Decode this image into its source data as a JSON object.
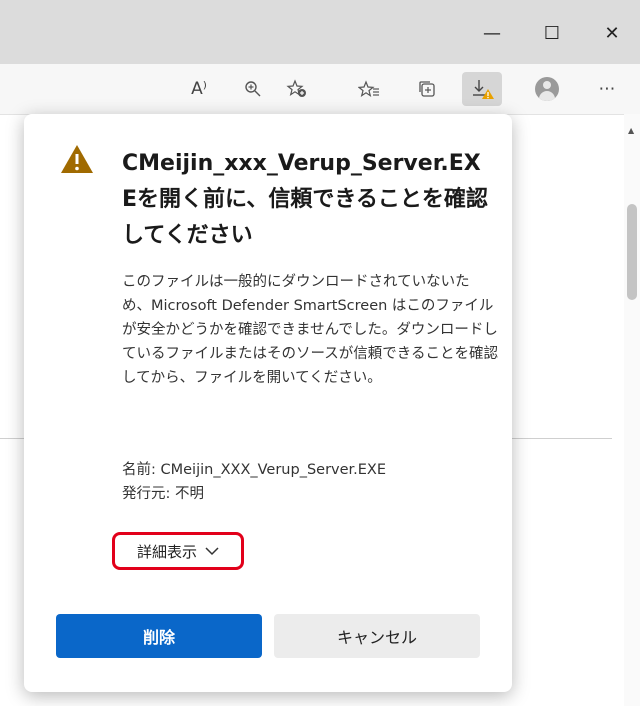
{
  "window": {
    "minimize": "—",
    "maximize": "☐",
    "close": "✕"
  },
  "toolbar": {
    "read_aloud": "A⁾",
    "more": "⋯"
  },
  "dialog": {
    "title": "CMeijin_xxx_Verup_Server.EXEを開く前に、信頼できることを確認してください",
    "body": "このファイルは一般的にダウンロードされていないため、Microsoft Defender SmartScreen はこのファイルが安全かどうかを確認できませんでした。ダウンロードしているファイルまたはそのソースが信頼できることを確認してから、ファイルを開いてください。",
    "name_line": "名前: CMeijin_XXX_Verup_Server.EXE",
    "publisher_line": "発行元: 不明",
    "details_label": "詳細表示",
    "delete_label": "削除",
    "cancel_label": "キャンセル"
  },
  "colors": {
    "primary_button": "#0a67c9",
    "highlight_box": "#e2001a",
    "warning_icon": "#a06a00"
  },
  "icons": [
    "minimize-icon",
    "maximize-icon",
    "close-icon",
    "read-aloud-icon",
    "zoom-icon",
    "add-favorite-icon",
    "favorites-icon",
    "collections-icon",
    "download-warning-icon",
    "profile-avatar-icon",
    "more-icon",
    "warning-icon",
    "chevron-down-icon"
  ]
}
